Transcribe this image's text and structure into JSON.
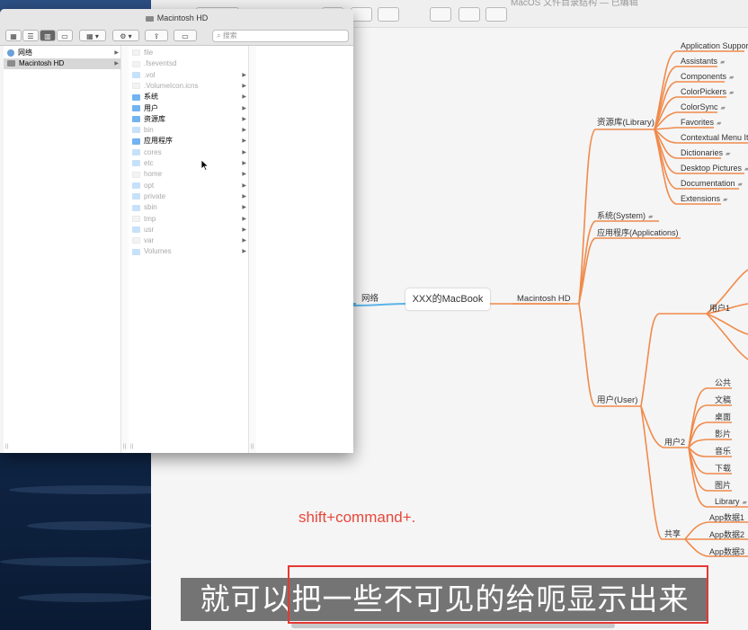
{
  "finder": {
    "title": "Macintosh HD",
    "search_placeholder": "搜索",
    "sidebar": [
      {
        "label": "网络",
        "icon": "globe-icon"
      },
      {
        "label": "Macintosh HD",
        "icon": "hard-drive-icon"
      }
    ],
    "files": [
      {
        "name": "file",
        "hidden": true,
        "folder": false,
        "arrow": false
      },
      {
        "name": ".fseventsd",
        "hidden": true,
        "folder": false,
        "arrow": false
      },
      {
        "name": ".vol",
        "hidden": true,
        "folder": true,
        "arrow": true
      },
      {
        "name": ".VolumeIcon.icns",
        "hidden": true,
        "folder": false,
        "arrow": true
      },
      {
        "name": "系统",
        "hidden": false,
        "folder": true,
        "arrow": true
      },
      {
        "name": "用户",
        "hidden": false,
        "folder": true,
        "arrow": true
      },
      {
        "name": "资源库",
        "hidden": false,
        "folder": true,
        "arrow": true
      },
      {
        "name": "bin",
        "hidden": true,
        "folder": true,
        "arrow": true
      },
      {
        "name": "应用程序",
        "hidden": false,
        "folder": true,
        "arrow": true
      },
      {
        "name": "cores",
        "hidden": true,
        "folder": true,
        "arrow": true
      },
      {
        "name": "etc",
        "hidden": true,
        "folder": true,
        "arrow": true
      },
      {
        "name": "home",
        "hidden": true,
        "folder": false,
        "arrow": true
      },
      {
        "name": "opt",
        "hidden": true,
        "folder": true,
        "arrow": true
      },
      {
        "name": "private",
        "hidden": true,
        "folder": true,
        "arrow": true
      },
      {
        "name": "sbin",
        "hidden": true,
        "folder": true,
        "arrow": true
      },
      {
        "name": "tmp",
        "hidden": true,
        "folder": false,
        "arrow": true
      },
      {
        "name": "usr",
        "hidden": true,
        "folder": true,
        "arrow": true
      },
      {
        "name": "var",
        "hidden": true,
        "folder": false,
        "arrow": true
      },
      {
        "name": "Volumes",
        "hidden": true,
        "folder": true,
        "arrow": true
      }
    ],
    "resize_handle": "||"
  },
  "mindmap": {
    "title": "MacOS 文件目录结构 — 已编辑",
    "center": "XXX的MacBook",
    "left_branch": "网络",
    "root": "Macintosh HD",
    "library": "资源库(Library)",
    "library_children": [
      "Application Suppor",
      "Assistants",
      "Components",
      "ColorPickers",
      "ColorSync",
      "Favorites",
      "Contextual Menu It",
      "Dictionaries",
      "Desktop Pictures",
      "Documentation",
      "Extensions"
    ],
    "system": "系统(System)",
    "applications": "应用程序(Applications)",
    "user": "用户(User)",
    "user1": "用户1",
    "user2": "用户2",
    "user2_children": [
      "公共",
      "文稿",
      "桌面",
      "影片",
      "音乐",
      "下载",
      "图片",
      "Library"
    ],
    "shared": "共享",
    "shared_children": [
      "App数据1",
      "App数据2",
      "App数据3"
    ],
    "note_glyph": "▰"
  },
  "overlay": {
    "hint": "shift+command+.",
    "subtitle": "就可以把一些不可见的给呃显示出来"
  }
}
